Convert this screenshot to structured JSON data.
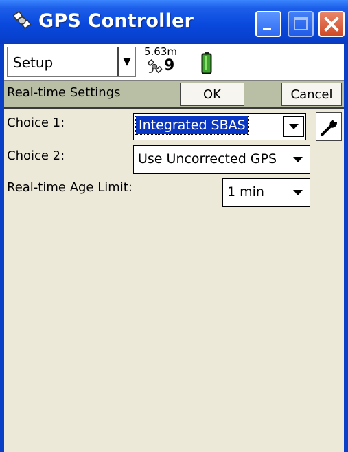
{
  "window": {
    "title": "GPS Controller",
    "title_icon": "satellite-app-icon",
    "buttons": [
      "minimize-icon",
      "maximize-icon",
      "close-icon"
    ]
  },
  "topbar": {
    "menu_label": "Setup",
    "gps": {
      "precision": "5.63m",
      "satellite_count": "9"
    },
    "battery_icon": "battery-icon",
    "battery_color": "#3aa52a"
  },
  "panel": {
    "title": "Real-time Settings",
    "ok_label": "OK",
    "cancel_label": "Cancel"
  },
  "fields": {
    "choice1": {
      "label": "Choice 1:",
      "value": "Integrated SBAS"
    },
    "choice2": {
      "label": "Choice 2:",
      "value": "Use Uncorrected GPS"
    },
    "age_limit": {
      "label": "Real-time Age Limit:",
      "value": "1 min"
    }
  },
  "colors": {
    "titlebar": "#0a49dd",
    "client_bg": "#ece9d8",
    "selection": "#0a36c4"
  }
}
